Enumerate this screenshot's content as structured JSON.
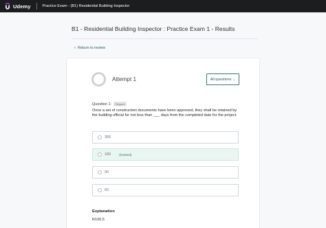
{
  "header": {
    "logo_text": "Udemy",
    "course_title": "Practice Exam - (B1) Residential Building Inspector"
  },
  "page": {
    "title": "B1 - Residential Building Inspector : Practice Exam 1 - Results",
    "back_link": "Return to review"
  },
  "attempt": {
    "label": "Attempt 1",
    "all_questions_label": "All questions"
  },
  "question": {
    "label": "Question 1:",
    "status_badge": "Skipped",
    "text": "Once a set of construction documents have been approved, they shall be retained by the building official for not less than ___ days from the completed date for the project.",
    "options": [
      {
        "label": "365",
        "tag": ""
      },
      {
        "label": "180",
        "tag": "(Correct)"
      },
      {
        "label": "90",
        "tag": ""
      },
      {
        "label": "60",
        "tag": ""
      }
    ]
  },
  "explanation": {
    "title": "Explanation",
    "text": "R106.5"
  },
  "colors": {
    "topbar": "#1c1d1f",
    "accent": "#1e6055",
    "correct_bg": "#eaf6f1",
    "logo": "#a435f0"
  },
  "icons": {
    "logo": "udemy-logo-icon",
    "back": "chevron-left-icon",
    "dropdown": "chevron-down-icon"
  }
}
